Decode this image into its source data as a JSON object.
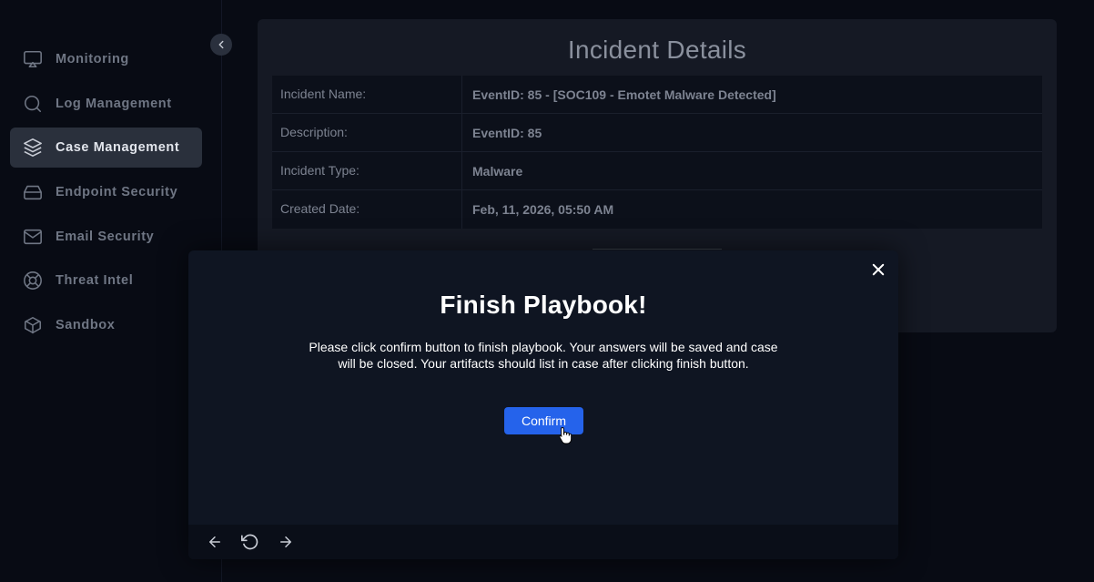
{
  "sidebar": {
    "items": [
      {
        "label": "Monitoring",
        "icon": "monitor-icon",
        "active": false
      },
      {
        "label": "Log Management",
        "icon": "search-icon",
        "active": false
      },
      {
        "label": "Case Management",
        "icon": "layers-icon",
        "active": true
      },
      {
        "label": "Endpoint Security",
        "icon": "hard-drive-icon",
        "active": false
      },
      {
        "label": "Email Security",
        "icon": "mail-icon",
        "active": false
      },
      {
        "label": "Threat Intel",
        "icon": "lifebuoy-icon",
        "active": false
      },
      {
        "label": "Sandbox",
        "icon": "box-icon",
        "active": false
      }
    ]
  },
  "card": {
    "title": "Incident Details",
    "rows": [
      {
        "label": "Incident Name:",
        "value": "EventID: 85 - [SOC109 - Emotet Malware Detected]"
      },
      {
        "label": "Description:",
        "value": "EventID: 85"
      },
      {
        "label": "Incident Type:",
        "value": "Malware"
      },
      {
        "label": "Created Date:",
        "value": "Feb, 11, 2026, 05:50 AM"
      }
    ]
  },
  "modal": {
    "title": "Finish Playbook!",
    "message_line1": "Please click confirm button to finish playbook. Your answers will be saved and case",
    "message_line2": "will be closed. Your artifacts should list in case after clicking finish button.",
    "confirm_label": "Confirm"
  },
  "colors": {
    "background": "#080b14",
    "accent": "#2563eb",
    "modal_bg": "#0f1522"
  }
}
